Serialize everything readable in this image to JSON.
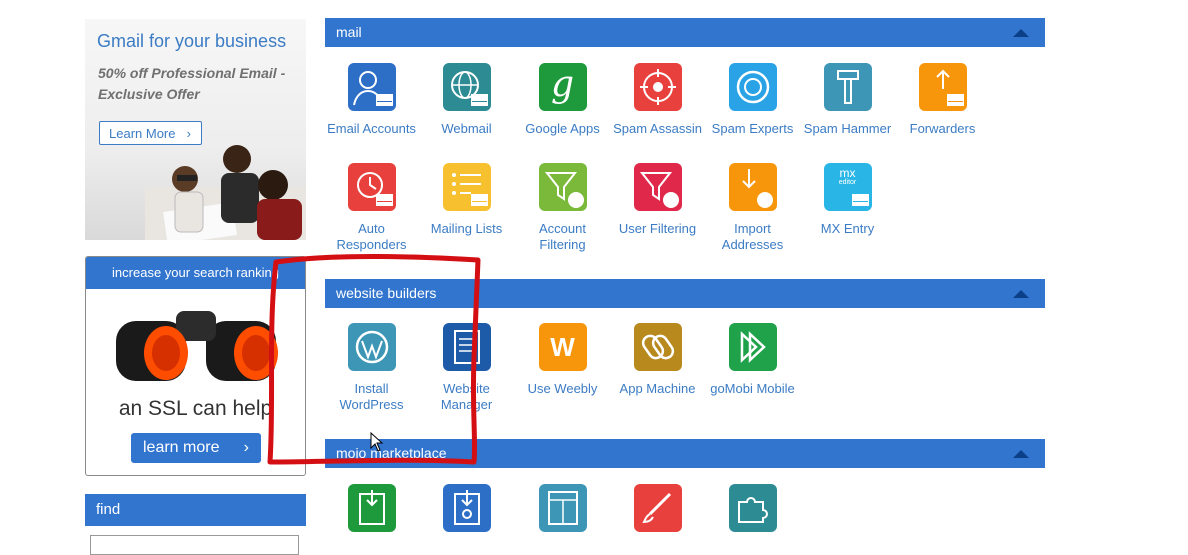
{
  "promo": {
    "title": "Gmail for your business",
    "subtitle": "50% off Professional Email - Exclusive Offer",
    "button": "Learn More",
    "chevron": "›"
  },
  "ssl": {
    "header": "increase your search ranking",
    "text": "an SSL can help",
    "button": "learn more",
    "chevron": "›"
  },
  "find": {
    "label": "find"
  },
  "sections": [
    {
      "title": "mail"
    },
    {
      "title": "website builders"
    },
    {
      "title": "mojo marketplace"
    }
  ],
  "mail": {
    "email_accounts": "Email Accounts",
    "webmail": "Webmail",
    "google_apps": "Google Apps",
    "spam_assassin": "Spam Assassin",
    "spam_experts": "Spam Experts",
    "spam_hammer": "Spam Hammer",
    "forwarders": "Forwarders",
    "auto_responders": "Auto Responders",
    "mailing_lists": "Mailing Lists",
    "account_filtering": "Account Filtering",
    "user_filtering": "User Filtering",
    "import_addresses": "Import Addresses",
    "mx_entry": "MX Entry"
  },
  "builders": {
    "install_wordpress": "Install WordPress",
    "website_manager": "Website Manager",
    "use_weebly": "Use Weebly",
    "app_machine": "App Machine",
    "gomobi": "goMobi Mobile"
  },
  "icons": {
    "google_glyph": "g",
    "weebly_glyph": "W",
    "mx_glyph": "mx",
    "mx_sub": "editor"
  },
  "colors": {
    "accent": "#3275cf",
    "link": "#3b7cc4",
    "annotation": "#d40f14"
  }
}
